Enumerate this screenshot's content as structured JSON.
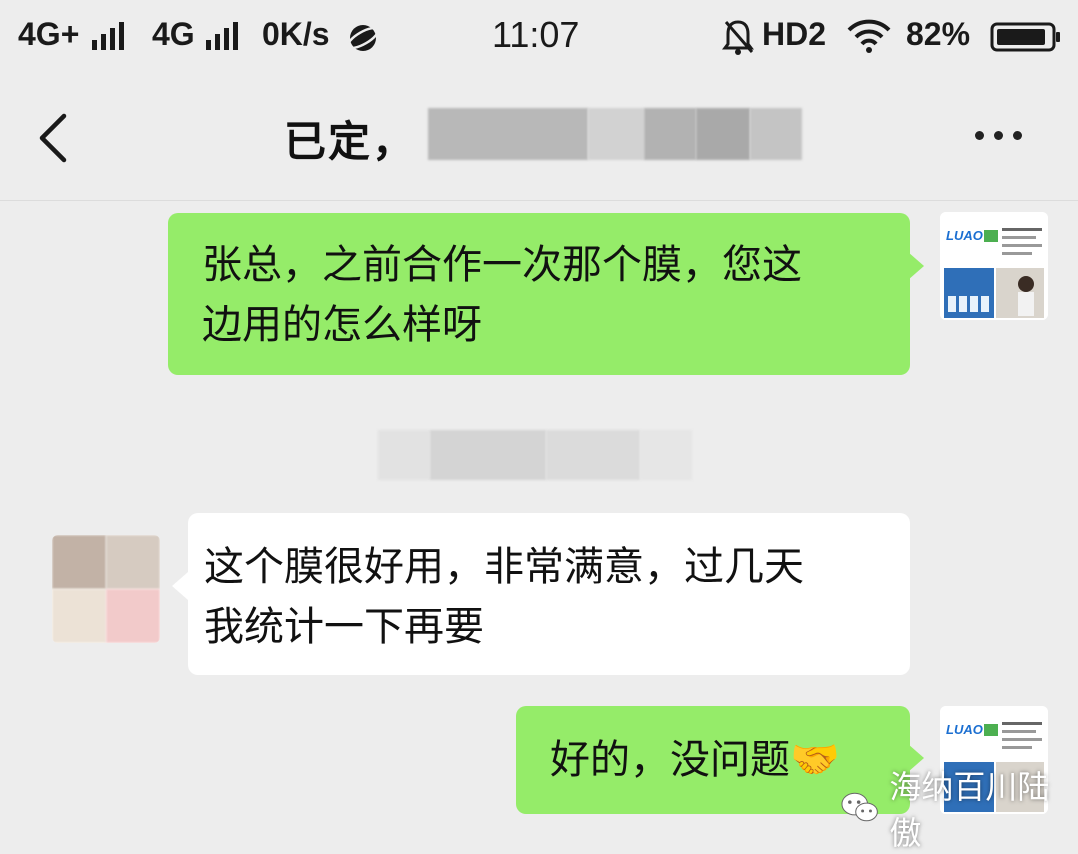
{
  "status_bar": {
    "network1": "4G+",
    "network2": "4G",
    "speed": "0K/s",
    "time": "11:07",
    "hd": "HD2",
    "battery": "82%"
  },
  "header": {
    "title": "已定，",
    "back_icon": "chevron-left-icon",
    "more_icon": "more-dots-icon"
  },
  "messages": [
    {
      "side": "right",
      "lines": [
        "张总，之前合作一次那个膜，您这",
        "边用的怎么样呀"
      ]
    },
    {
      "side": "left",
      "lines": [
        "这个膜很好用，非常满意，过几天",
        "我统计一下再要"
      ]
    },
    {
      "side": "right",
      "text": "好的，没问题",
      "emoji": "🤝"
    }
  ],
  "avatar_brand": "LUAO",
  "watermark": "海纳百川陆傲",
  "colors": {
    "sent_bubble": "#95ec69",
    "received_bubble": "#ffffff",
    "background": "#ededed"
  }
}
